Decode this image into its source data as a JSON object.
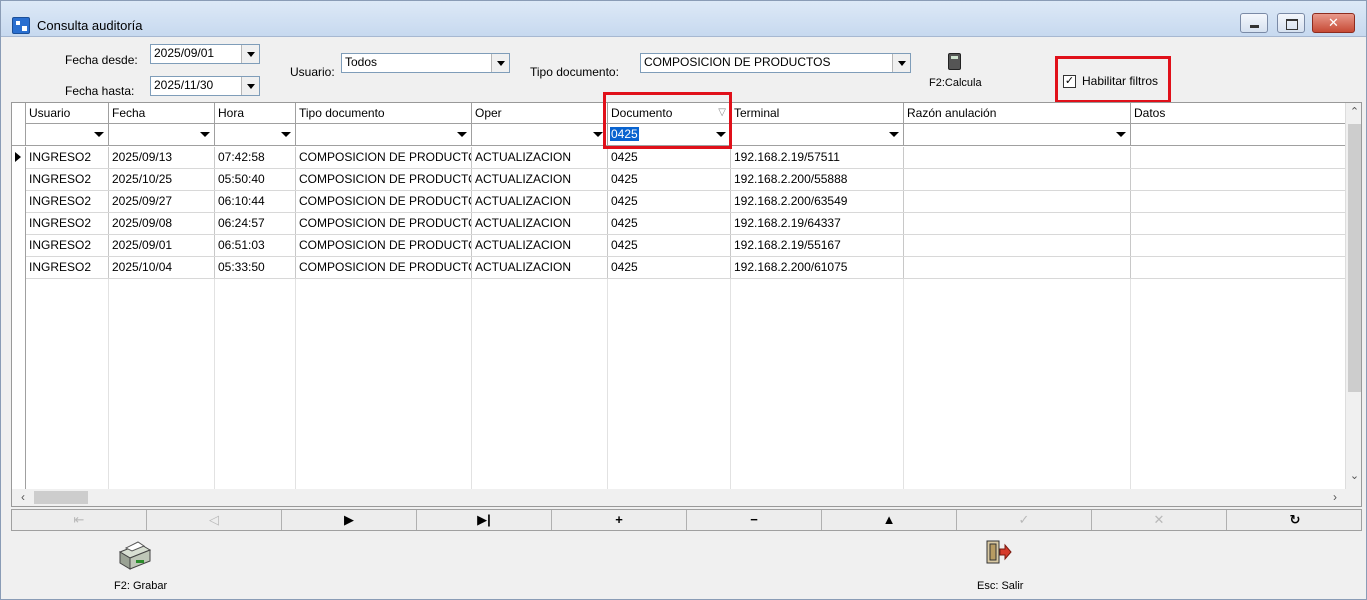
{
  "window": {
    "title": "Consulta auditoría"
  },
  "filters": {
    "fecha_desde_label": "Fecha desde:",
    "fecha_desde_value": "2025/09/01",
    "fecha_hasta_label": "Fecha hasta:",
    "fecha_hasta_value": "2025/11/30",
    "usuario_label": "Usuario:",
    "usuario_value": "Todos",
    "tipo_documento_label": "Tipo documento:",
    "tipo_documento_value": "COMPOSICION DE PRODUCTOS",
    "calc_label": "F2:Calcula",
    "habilitar_filtros_label": "Habilitar filtros",
    "habilitar_filtros_checked": "✓"
  },
  "grid": {
    "columns": [
      "Usuario",
      "Fecha",
      "Hora",
      "Tipo documento",
      "Oper",
      "Documento",
      "Terminal",
      "Razón anulación",
      "Datos"
    ],
    "filter_values": [
      "",
      "",
      "",
      "",
      "",
      "0425",
      "",
      "",
      ""
    ],
    "sort_glyph": "▽",
    "rows": [
      [
        "INGRESO2",
        "2025/09/13",
        "07:42:58",
        "COMPOSICION DE PRODUCTOS",
        "ACTUALIZACION",
        "0425",
        "192.168.2.19/57511",
        "",
        ""
      ],
      [
        "INGRESO2",
        "2025/10/25",
        "05:50:40",
        "COMPOSICION DE PRODUCTOS",
        "ACTUALIZACION",
        "0425",
        "192.168.2.200/55888",
        "",
        ""
      ],
      [
        "INGRESO2",
        "2025/09/27",
        "06:10:44",
        "COMPOSICION DE PRODUCTOS",
        "ACTUALIZACION",
        "0425",
        "192.168.2.200/63549",
        "",
        ""
      ],
      [
        "INGRESO2",
        "2025/09/08",
        "06:24:57",
        "COMPOSICION DE PRODUCTOS",
        "ACTUALIZACION",
        "0425",
        "192.168.2.19/64337",
        "",
        ""
      ],
      [
        "INGRESO2",
        "2025/09/01",
        "06:51:03",
        "COMPOSICION DE PRODUCTOS",
        "ACTUALIZACION",
        "0425",
        "192.168.2.19/55167",
        "",
        ""
      ],
      [
        "INGRESO2",
        "2025/10/04",
        "05:33:50",
        "COMPOSICION DE PRODUCTOS",
        "ACTUALIZACION",
        "0425",
        "192.168.2.200/61075",
        "",
        ""
      ]
    ]
  },
  "navigator": [
    {
      "name": "first",
      "glyph": "⇤",
      "disabled": true
    },
    {
      "name": "prior",
      "glyph": "◁",
      "disabled": true
    },
    {
      "name": "next",
      "glyph": "▶",
      "disabled": false
    },
    {
      "name": "last",
      "glyph": "▶|",
      "disabled": false
    },
    {
      "name": "insert",
      "glyph": "+",
      "disabled": false
    },
    {
      "name": "delete",
      "glyph": "−",
      "disabled": false
    },
    {
      "name": "edit",
      "glyph": "▲",
      "disabled": false
    },
    {
      "name": "post",
      "glyph": "✓",
      "disabled": true
    },
    {
      "name": "cancel",
      "glyph": "✕",
      "disabled": true
    },
    {
      "name": "refresh",
      "glyph": "↻",
      "disabled": false
    }
  ],
  "toolbar": {
    "grabar_label": "F2: Grabar",
    "salir_label": "Esc: Salir"
  },
  "colors": {
    "highlight_box": "#e0101a",
    "selection": "#0a64d0"
  }
}
